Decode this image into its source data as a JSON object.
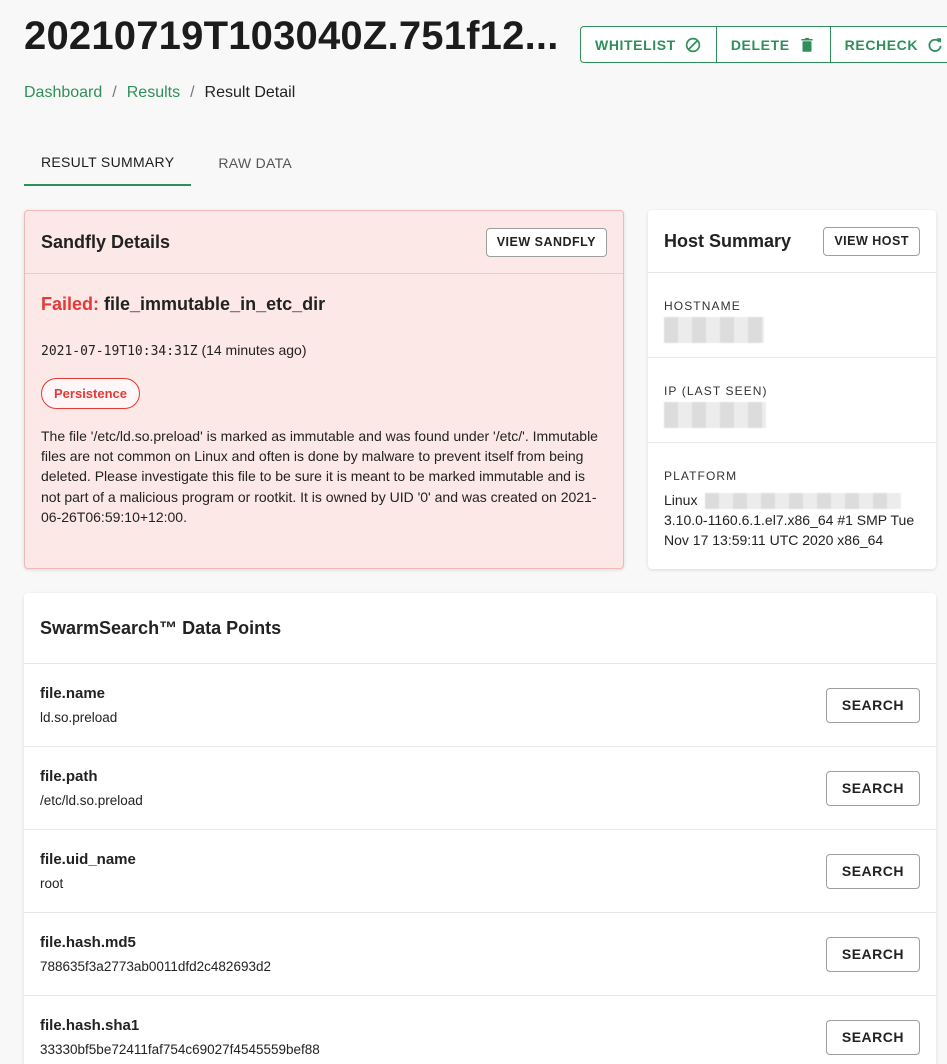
{
  "header": {
    "title": "20210719T103040Z.751f12...",
    "actions": [
      {
        "label": "WHITELIST",
        "icon": "block-icon"
      },
      {
        "label": "DELETE",
        "icon": "trash-icon"
      },
      {
        "label": "RECHECK",
        "icon": "refresh-icon"
      }
    ]
  },
  "breadcrumb": {
    "items": [
      "Dashboard",
      "Results"
    ],
    "current": "Result Detail",
    "separator": "/"
  },
  "tabs": [
    {
      "label": "RESULT SUMMARY",
      "active": true
    },
    {
      "label": "RAW DATA",
      "active": false
    }
  ],
  "sandfly": {
    "title": "Sandfly Details",
    "button": "VIEW SANDFLY",
    "status": "Failed:",
    "name": "file_immutable_in_etc_dir",
    "timestamp": "2021-07-19T10:34:31Z",
    "relative_time": "(14 minutes ago)",
    "tag": "Persistence",
    "description": "The file '/etc/ld.so.preload' is marked as immutable and was found under '/etc/'. Immutable files are not common on Linux and often is done by malware to prevent itself from being deleted. Please investigate this file to be sure it is meant to be marked immutable and is not part of a malicious program or rootkit. It is owned by UID '0' and was created on 2021-06-26T06:59:10+12:00."
  },
  "host": {
    "title": "Host Summary",
    "button": "VIEW HOST",
    "hostname_label": "HOSTNAME",
    "ip_label": "IP (LAST SEEN)",
    "platform_label": "PLATFORM",
    "platform_prefix": "Linux",
    "platform_value": "3.10.0-1160.6.1.el7.x86_64 #1 SMP Tue Nov 17 13:59:11 UTC 2020 x86_64"
  },
  "swarm": {
    "title": "SwarmSearch™ Data Points",
    "search_label": "SEARCH",
    "rows": [
      {
        "key": "file.name",
        "value": "ld.so.preload"
      },
      {
        "key": "file.path",
        "value": "/etc/ld.so.preload"
      },
      {
        "key": "file.uid_name",
        "value": "root"
      },
      {
        "key": "file.hash.md5",
        "value": "788635f3a2773ab0011dfd2c482693d2"
      },
      {
        "key": "file.hash.sha1",
        "value": "33330bf5be72411faf754c69027f4545559bef88"
      }
    ]
  },
  "colors": {
    "accent": "#2f8f5b",
    "danger": "#e53935",
    "alert_bg": "#fde8e8"
  }
}
